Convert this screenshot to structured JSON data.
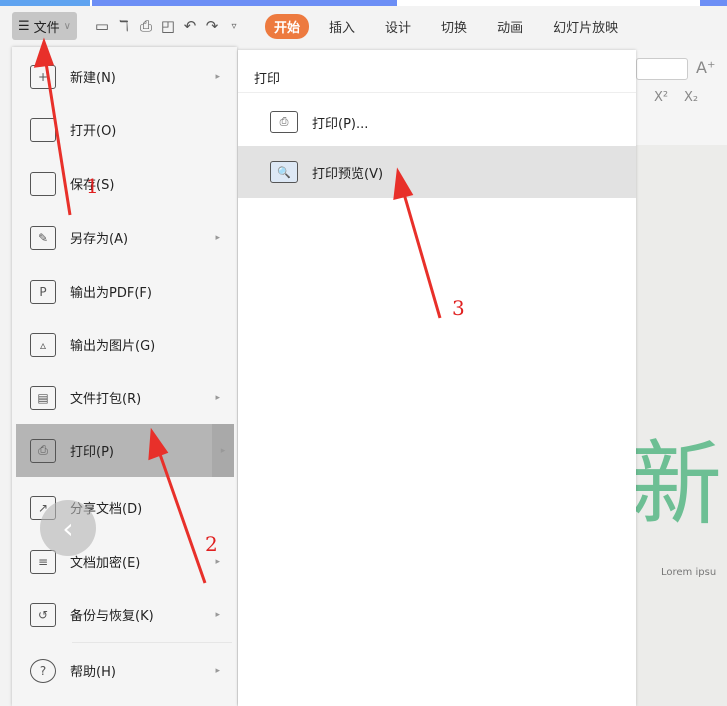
{
  "toolbar": {
    "file_label": "文件",
    "tabs": [
      "开始",
      "插入",
      "设计",
      "切换",
      "动画",
      "幻灯片放映"
    ],
    "icons": [
      "save-icon",
      "format-painter-icon",
      "print-icon",
      "print-preview-icon",
      "undo-icon",
      "redo-icon",
      "customize-icon"
    ]
  },
  "menu": {
    "items": [
      {
        "label": "新建(N)",
        "icon": "new-icon",
        "glyph": "+",
        "submenu": true
      },
      {
        "label": "打开(O)",
        "icon": "folder-icon",
        "glyph": "",
        "submenu": false
      },
      {
        "label": "保存(S)",
        "icon": "save-icon",
        "glyph": "",
        "submenu": false
      },
      {
        "label": "另存为(A)",
        "icon": "save-as-icon",
        "glyph": "✎",
        "submenu": true
      },
      {
        "label": "输出为PDF(F)",
        "icon": "pdf-icon",
        "glyph": "P",
        "submenu": false
      },
      {
        "label": "输出为图片(G)",
        "icon": "image-icon",
        "glyph": "▵",
        "submenu": false
      },
      {
        "label": "文件打包(R)",
        "icon": "package-icon",
        "glyph": "▤",
        "submenu": true
      },
      {
        "label": "打印(P)",
        "icon": "print-icon",
        "glyph": "⎙",
        "submenu": true
      },
      {
        "label": "分享文档(D)",
        "icon": "share-icon",
        "glyph": "↗",
        "submenu": false
      },
      {
        "label": "文档加密(E)",
        "icon": "encrypt-icon",
        "glyph": "≡",
        "submenu": true
      },
      {
        "label": "备份与恢复(K)",
        "icon": "backup-icon",
        "glyph": "↺",
        "submenu": true
      },
      {
        "label": "帮助(H)",
        "icon": "help-icon",
        "glyph": "?",
        "submenu": true
      }
    ],
    "active_index": 7
  },
  "submenu": {
    "title": "打印",
    "items": [
      {
        "label": "打印(P)...",
        "icon": "print-icon",
        "glyph": "⎙"
      },
      {
        "label": "打印预览(V)",
        "icon": "print-preview-icon",
        "glyph": "🔍"
      }
    ],
    "hover_index": 1
  },
  "slide": {
    "title_char": "新",
    "subtitle": "Lorem ipsu"
  },
  "right_toolbar": {
    "font_grow": "A⁺",
    "superscript": "X²",
    "subscript": "X₂"
  },
  "annotations": {
    "labels": [
      "1",
      "2",
      "3"
    ],
    "color": "#e02020"
  },
  "colors": {
    "accent": "#ed7a3f",
    "slide_text": "#6dbf94"
  }
}
